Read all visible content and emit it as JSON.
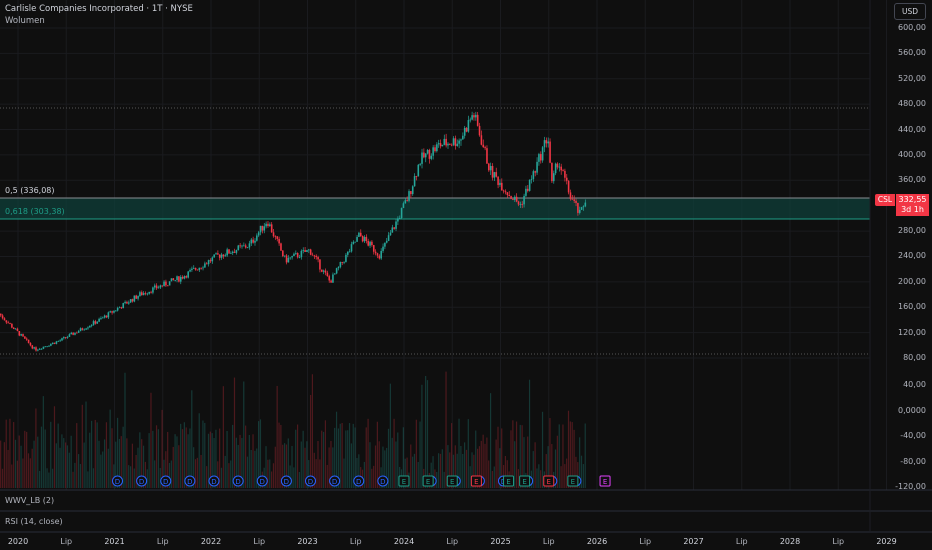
{
  "header": {
    "title": "Carlisle Companies Incorporated · 1T · NYSE",
    "volume_label": "Wolumen",
    "currency_button": "USD"
  },
  "fib_levels": [
    {
      "label": "0,5 (336,08)",
      "price": 336.08,
      "color": "#d1d4dc"
    },
    {
      "label": "0,618 (303,38)",
      "price": 303.38,
      "color": "#1e9d87"
    }
  ],
  "price_tag": {
    "symbol": "CSL",
    "price": "332,55",
    "countdown": "3d 1h",
    "color": "#f23645"
  },
  "price_axis": [
    "600,00",
    "560,00",
    "520,00",
    "480,00",
    "440,00",
    "400,00",
    "360,00",
    "280,00",
    "240,00",
    "200,00",
    "160,00",
    "120,00",
    "80,00"
  ],
  "indicator_axis": [
    "40,00",
    "0,0000",
    "-40,00",
    "-80,00",
    "-120,00"
  ],
  "time_axis": [
    "2020",
    "Lip",
    "2021",
    "Lip",
    "2022",
    "Lip",
    "2023",
    "Lip",
    "2024",
    "Lip",
    "2025",
    "Lip",
    "2026",
    "Lip",
    "2027",
    "Lip",
    "2028",
    "Lip",
    "2029"
  ],
  "panes": {
    "wwv": "WWV_LB (2)",
    "rsi": "RSI (14, close)"
  },
  "colors": {
    "up": "#26a69a",
    "down": "#f23645",
    "dividend": "#2962ff",
    "earnings_up": "#1e9d87",
    "earnings_down": "#f23645",
    "earnings_future": "#e040fb"
  },
  "events": {
    "dividend_label": "D",
    "earnings_label": "E",
    "dividends": [
      "2021-01",
      "2021-04",
      "2021-07",
      "2021-10",
      "2022-01",
      "2022-04",
      "2022-07",
      "2022-10",
      "2023-01",
      "2023-04",
      "2023-07",
      "2023-10",
      "2024-04",
      "2024-07",
      "2024-10",
      "2025-01",
      "2025-04",
      "2025-07",
      "2025-10"
    ],
    "earnings": [
      {
        "date": "2024-01",
        "result": "up"
      },
      {
        "date": "2024-04",
        "result": "up"
      },
      {
        "date": "2024-07",
        "result": "up"
      },
      {
        "date": "2024-10",
        "result": "down"
      },
      {
        "date": "2025-02",
        "result": "up"
      },
      {
        "date": "2025-04",
        "result": "up"
      },
      {
        "date": "2025-07",
        "result": "down"
      },
      {
        "date": "2025-10",
        "result": "up"
      },
      {
        "date": "2026-02",
        "result": "future"
      }
    ]
  },
  "chart_data": {
    "type": "candlestick",
    "ylim": [
      80,
      600
    ],
    "path": [
      [
        "2019-10-20",
        150
      ],
      [
        "2020-03-05",
        93
      ],
      [
        "2020-06-10",
        108
      ],
      [
        "2020-11-05",
        140
      ],
      [
        "2021-04-05",
        180
      ],
      [
        "2021-09-05",
        206
      ],
      [
        "2022-02-01",
        242
      ],
      [
        "2022-05-25",
        258
      ],
      [
        "2022-08-01",
        297
      ],
      [
        "2022-10-08",
        234
      ],
      [
        "2023-01-10",
        250
      ],
      [
        "2023-03-25",
        200
      ],
      [
        "2023-07-15",
        274
      ],
      [
        "2023-10-01",
        242
      ],
      [
        "2023-12-15",
        305
      ],
      [
        "2024-01-20",
        337
      ],
      [
        "2024-03-01",
        392
      ],
      [
        "2024-05-15",
        416
      ],
      [
        "2024-07-30",
        424
      ],
      [
        "2024-09-20",
        466
      ],
      [
        "2024-10-15",
        431
      ],
      [
        "2024-11-22",
        376
      ],
      [
        "2025-02-05",
        337
      ],
      [
        "2025-03-15",
        321
      ],
      [
        "2025-05-10",
        376
      ],
      [
        "2025-06-28",
        431
      ],
      [
        "2025-07-13",
        352
      ],
      [
        "2025-08-05",
        392
      ],
      [
        "2025-09-20",
        337
      ],
      [
        "2025-10-28",
        305
      ],
      [
        "2025-11-20",
        332.55
      ]
    ]
  }
}
